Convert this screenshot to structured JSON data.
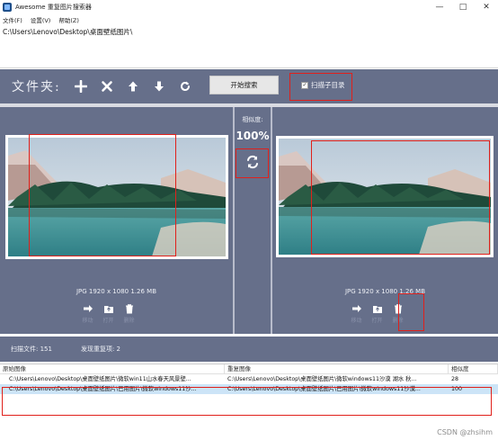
{
  "window": {
    "title": "Awesome 重复图片搜索器",
    "controls": [
      "minimize-icon",
      "maximize-icon",
      "close-icon"
    ]
  },
  "menu": [
    "文件(F)",
    "设置(V)",
    "帮助(Z)"
  ],
  "path_list": [
    "C:\\Users\\Lenovo\\Desktop\\桌面壁纸图片\\"
  ],
  "toolbar": {
    "folder_label": "文件夹:",
    "icons": [
      "add-icon",
      "remove-icon",
      "move-up-icon",
      "move-down-icon",
      "refresh-icon"
    ],
    "start_button": "开始搜索",
    "subdir_label": "扫描子目录",
    "subdir_checked": true
  },
  "left_image": {
    "info": "JPG  1920 x 1080  1.26 MB",
    "actions": [
      "移动",
      "打开",
      "删除"
    ]
  },
  "right_image": {
    "info": "JPG  1920 x 1080  1.26 MB",
    "actions": [
      "移动",
      "打开",
      "删除"
    ]
  },
  "similarity": {
    "label": "相似度:",
    "value": "100%"
  },
  "status": {
    "scanned": "扫描文件: 151",
    "duplicates": "发现重复项: 2"
  },
  "table": {
    "columns": [
      "原始图像",
      "重复图像",
      "相似度"
    ],
    "rows": [
      {
        "original": "C:\\Users\\Lenovo\\Desktop\\桌面壁纸图片\\微软win11山水春天风景壁...",
        "duplicate": "C:\\Users\\Lenovo\\Desktop\\桌面壁纸图片\\微软windows11沙漠 湖水 秋...",
        "similarity": "28"
      },
      {
        "original": "C:\\Users\\Lenovo\\Desktop\\桌面壁纸图片\\已用图片\\微软windows11沙...",
        "duplicate": "C:\\Users\\Lenovo\\Desktop\\桌面壁纸图片\\已用图片\\微软windows11沙漠...",
        "similarity": "100"
      }
    ]
  },
  "watermark": "CSDN @zhsihm",
  "colors": {
    "panel_bg": "#666f8a",
    "highlight": "#e0201b",
    "selected_row": "#cce4f7"
  }
}
